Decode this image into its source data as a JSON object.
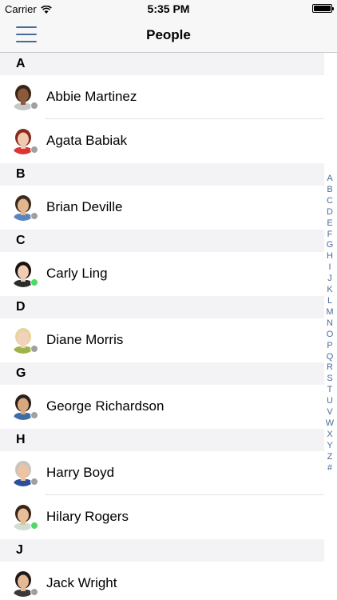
{
  "status_bar": {
    "carrier": "Carrier",
    "time": "5:35 PM"
  },
  "nav": {
    "title": "People"
  },
  "sections": [
    {
      "letter": "A",
      "contacts": [
        {
          "name": "Abbie Martinez",
          "online": false,
          "skin": "#8a5a3c",
          "hair": "#3a2418",
          "shirt": "#c8c8c8"
        },
        {
          "name": "Agata Babiak",
          "online": false,
          "skin": "#f1c9b0",
          "hair": "#8a2a1c",
          "shirt": "#d33"
        }
      ]
    },
    {
      "letter": "B",
      "contacts": [
        {
          "name": "Brian Deville",
          "online": false,
          "skin": "#e2b58e",
          "hair": "#3b2a1e",
          "shirt": "#5a86c0"
        }
      ]
    },
    {
      "letter": "C",
      "contacts": [
        {
          "name": "Carly Ling",
          "online": true,
          "skin": "#f0cdb2",
          "hair": "#1a1210",
          "shirt": "#2c2c2c"
        }
      ]
    },
    {
      "letter": "D",
      "contacts": [
        {
          "name": "Diane Morris",
          "online": false,
          "skin": "#f3d2bd",
          "hair": "#e6d59e",
          "shirt": "#9fb34a"
        }
      ]
    },
    {
      "letter": "G",
      "contacts": [
        {
          "name": "George Richardson",
          "online": false,
          "skin": "#d9a77d",
          "hair": "#2b2018",
          "shirt": "#3b6ea8"
        }
      ]
    },
    {
      "letter": "H",
      "contacts": [
        {
          "name": "Harry Boyd",
          "online": false,
          "skin": "#efc2a2",
          "hair": "#c9c4bd",
          "shirt": "#2d4f9a"
        },
        {
          "name": "Hilary Rogers",
          "online": true,
          "skin": "#e8bd9a",
          "hair": "#3a2418",
          "shirt": "#cde1d0"
        }
      ]
    },
    {
      "letter": "J",
      "contacts": [
        {
          "name": "Jack Wright",
          "online": false,
          "skin": "#e6b995",
          "hair": "#1f1a16",
          "shirt": "#3a3a3a"
        }
      ]
    }
  ],
  "index_letters": [
    "A",
    "B",
    "C",
    "D",
    "E",
    "F",
    "G",
    "H",
    "I",
    "J",
    "K",
    "L",
    "M",
    "N",
    "O",
    "P",
    "Q",
    "R",
    "S",
    "T",
    "U",
    "V",
    "W",
    "X",
    "Y",
    "Z",
    "#"
  ],
  "colors": {
    "accent": "#4a6b98",
    "online": "#4cd964",
    "offline": "#a0a0a0"
  }
}
